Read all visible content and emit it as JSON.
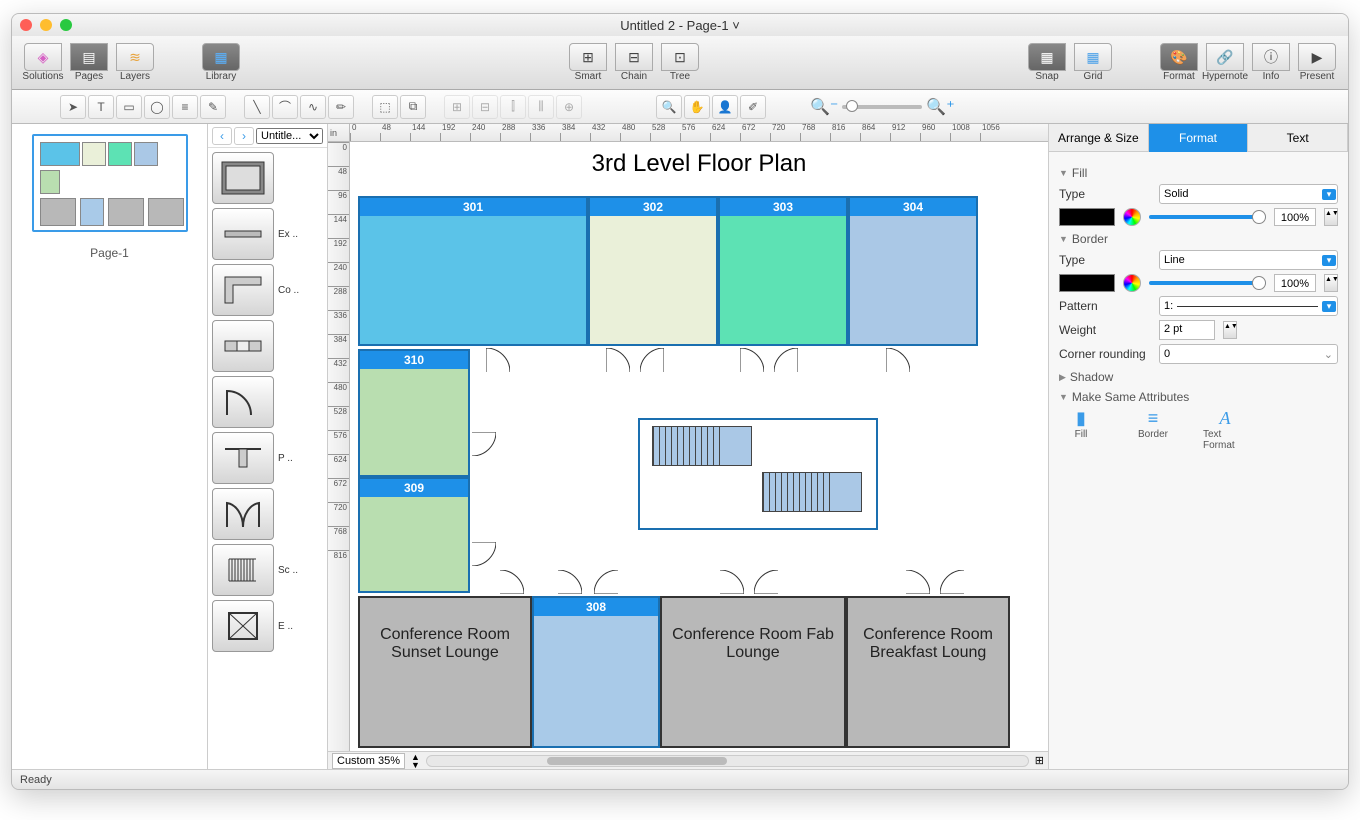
{
  "window_title": "Untitled 2 - Page-1 ˅",
  "toolbar": {
    "left": [
      {
        "label": "Solutions",
        "glyph": "◈",
        "active": false
      },
      {
        "label": "Pages",
        "glyph": "▦",
        "active": true
      },
      {
        "label": "Layers",
        "glyph": "≋",
        "active": false
      }
    ],
    "library": {
      "label": "Library",
      "glyph": "▦",
      "active": true
    },
    "center": [
      {
        "label": "Smart",
        "glyph": "⊞"
      },
      {
        "label": "Chain",
        "glyph": "⊟"
      },
      {
        "label": "Tree",
        "glyph": "⊡"
      }
    ],
    "snapgrid": [
      {
        "label": "Snap",
        "glyph": "▦",
        "active": true
      },
      {
        "label": "Grid",
        "glyph": "▦",
        "active": false
      }
    ],
    "right": [
      {
        "label": "Format",
        "glyph": "🎨"
      },
      {
        "label": "Hypernote",
        "glyph": "🔗"
      },
      {
        "label": "Info",
        "glyph": "ⓘ"
      },
      {
        "label": "Present",
        "glyph": "▶"
      }
    ]
  },
  "pages": {
    "thumb_label": "Page-1"
  },
  "library_nav": {
    "select": "Untitle..."
  },
  "library_items": [
    {
      "abbr": ""
    },
    {
      "abbr": "Ex .."
    },
    {
      "abbr": "Co .."
    },
    {
      "abbr": ""
    },
    {
      "abbr": ""
    },
    {
      "abbr": "P .."
    },
    {
      "abbr": ""
    },
    {
      "abbr": "Sc .."
    },
    {
      "abbr": "E .."
    }
  ],
  "ruler_unit": "in",
  "ruler_h": [
    "0",
    "48",
    "144",
    "192",
    "240",
    "288",
    "336",
    "384",
    "432",
    "480",
    "528",
    "576",
    "624",
    "672",
    "720",
    "768",
    "816",
    "864",
    "912",
    "960",
    "1008",
    "1056"
  ],
  "ruler_v": [
    "0",
    "48",
    "96",
    "144",
    "192",
    "240",
    "288",
    "336",
    "384",
    "432",
    "480",
    "528",
    "576",
    "624",
    "672",
    "720",
    "768",
    "816"
  ],
  "floorplan": {
    "title": "3rd Level Floor Plan",
    "rooms": {
      "r301": "301",
      "r302": "302",
      "r303": "303",
      "r304": "304",
      "r308": "308",
      "r309": "309",
      "r310": "310"
    },
    "conf": [
      "Conference Room Sunset Lounge",
      "Conference Room Fab Lounge",
      "Conference Room Breakfast Loung"
    ]
  },
  "zoom_select": "Custom 35%",
  "inspector": {
    "tabs": [
      "Arrange & Size",
      "Format",
      "Text"
    ],
    "fill": {
      "header": "Fill",
      "type_label": "Type",
      "type_value": "Solid",
      "pct": "100%"
    },
    "border": {
      "header": "Border",
      "type_label": "Type",
      "type_value": "Line",
      "pct": "100%",
      "pattern_label": "Pattern",
      "pattern_value": "1:",
      "weight_label": "Weight",
      "weight_value": "2 pt",
      "corner_label": "Corner rounding",
      "corner_value": "0"
    },
    "shadow": {
      "header": "Shadow"
    },
    "same": {
      "header": "Make Same Attributes",
      "fill": "Fill",
      "border": "Border",
      "text": "Text Format"
    }
  },
  "status": "Ready"
}
